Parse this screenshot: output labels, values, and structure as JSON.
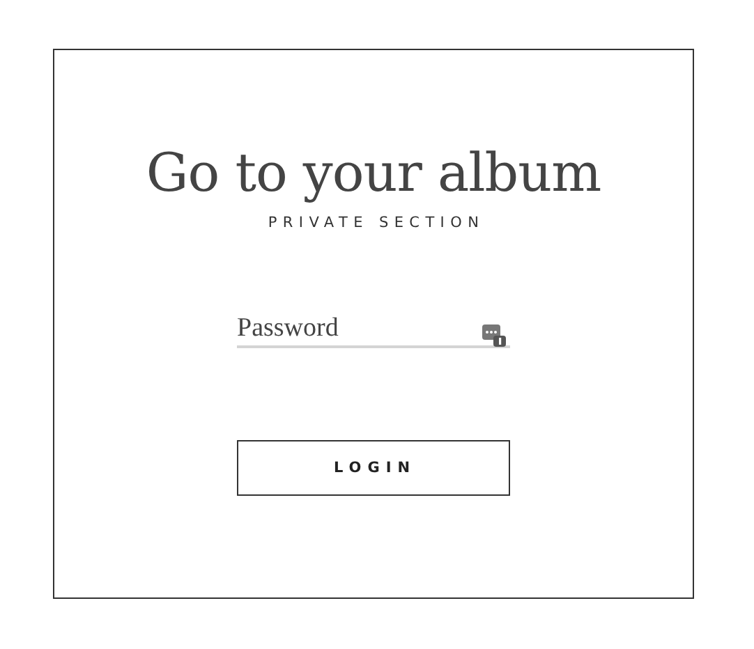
{
  "title": "Go to your album",
  "subtitle": "PRIVATE SECTION",
  "password": {
    "placeholder": "Password"
  },
  "button": "LOGIN"
}
